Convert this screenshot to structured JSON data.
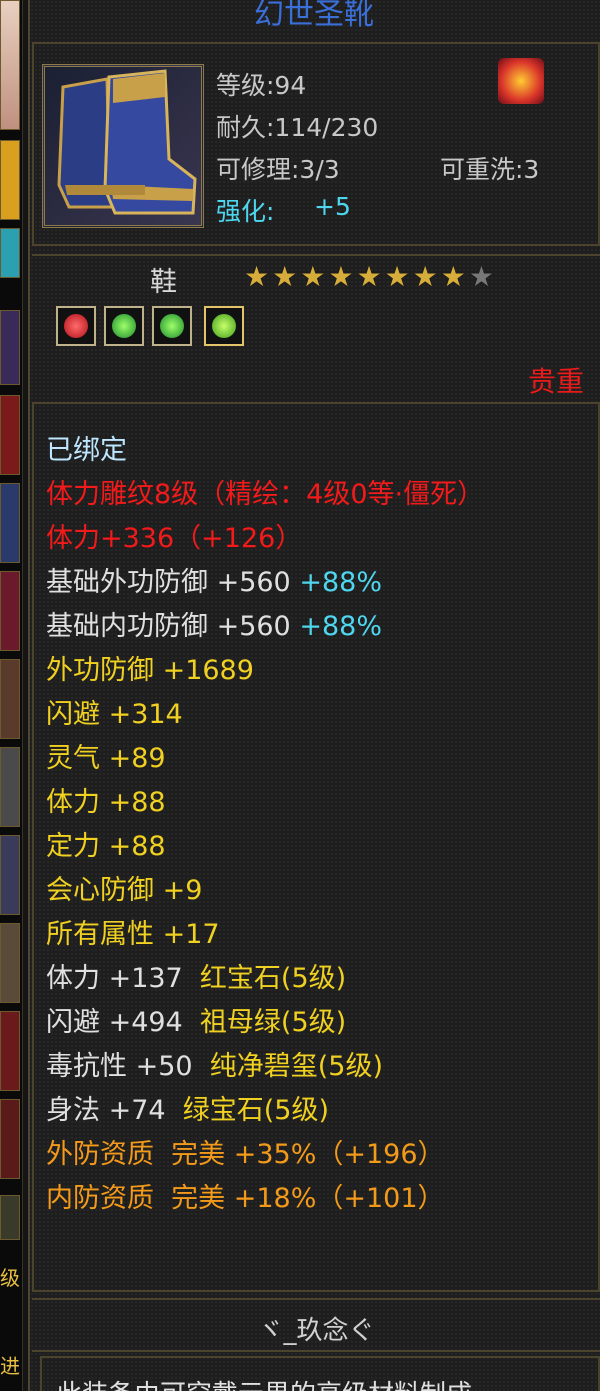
{
  "item": {
    "name": "幻世圣靴",
    "level": "等级:94",
    "durability": "耐久:114/230",
    "repairable": "可修理:3/3",
    "rewash": "可重洗:3",
    "enhance_label": "强化:",
    "enhance_value": "+5",
    "type": "鞋",
    "rarity": "贵重",
    "stars": {
      "filled": 8,
      "total": 9
    },
    "gems": [
      "red",
      "green",
      "green",
      "green"
    ]
  },
  "attributes": {
    "bound": "已绑定",
    "carve": "体力雕纹8级（精绘：4级0等·僵死）",
    "stamina_total": "体力+336（+126）",
    "base_outer_def": "基础外功防御 +560",
    "base_outer_def_pct": "+88%",
    "base_inner_def": "基础内功防御 +560",
    "base_inner_def_pct": "+88%",
    "outer_def": "外功防御 +1689",
    "dodge": "闪避 +314",
    "spirit": "灵气 +89",
    "stamina": "体力 +88",
    "focus": "定力 +88",
    "crit_def": "会心防御 +9",
    "all_attr": "所有属性 +17",
    "gem1_stat": "体力 +137",
    "gem1_name": "红宝石(5级)",
    "gem2_stat": "闪避 +494",
    "gem2_name": "祖母绿(5级)",
    "gem3_stat": "毒抗性 +50",
    "gem3_name": "纯净碧玺(5级)",
    "gem4_stat": "身法 +74",
    "gem4_name": "绿宝石(5级)",
    "quality1": "外防资质  完美 +35%（+196）",
    "quality2": "内防资质  完美 +18%（+101）"
  },
  "footer": {
    "maker": "ヾ_玖念ぐ",
    "desc": "此装备由可穿戴元界的高级材料制成"
  },
  "left_strip": {
    "labels": [
      "级",
      "进"
    ]
  }
}
